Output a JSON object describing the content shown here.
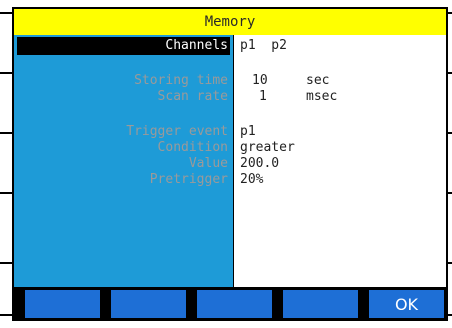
{
  "title": "Memory",
  "fields": {
    "channels": {
      "label": "Channels",
      "value": "p1  p2"
    },
    "storing_time": {
      "label": "Storing time",
      "value": "10",
      "unit": "sec"
    },
    "scan_rate": {
      "label": "Scan rate",
      "value": "1",
      "unit": "msec"
    },
    "trigger_event": {
      "label": "Trigger event",
      "value": "p1"
    },
    "condition": {
      "label": "Condition",
      "value": "greater"
    },
    "value": {
      "label": "Value",
      "value": "200.0"
    },
    "pretrigger": {
      "label": "Pretrigger",
      "value": "20%"
    }
  },
  "softkeys": {
    "f1": "",
    "f2": "",
    "f3": "",
    "f4": "",
    "ok": "OK"
  },
  "colors": {
    "title_bg": "#ffff00",
    "label_panel": "#1e9bd7",
    "softkey": "#1e6fd6"
  }
}
